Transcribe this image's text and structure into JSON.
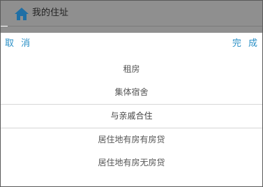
{
  "header": {
    "icon": "home-icon",
    "title": "我的住址"
  },
  "picker": {
    "cancel_label": "取 消",
    "done_label": "完 成",
    "options": [
      {
        "label": "租房"
      },
      {
        "label": "集体宿舍"
      },
      {
        "label": "与亲戚合住"
      },
      {
        "label": "居住地有房有房贷"
      },
      {
        "label": "居住地有房无房贷"
      }
    ],
    "selected_label": "与亲戚合住"
  },
  "colors": {
    "accent": "#2a8fc6",
    "overlay": "#8f8f8f",
    "icon": "#1f6fa5"
  }
}
